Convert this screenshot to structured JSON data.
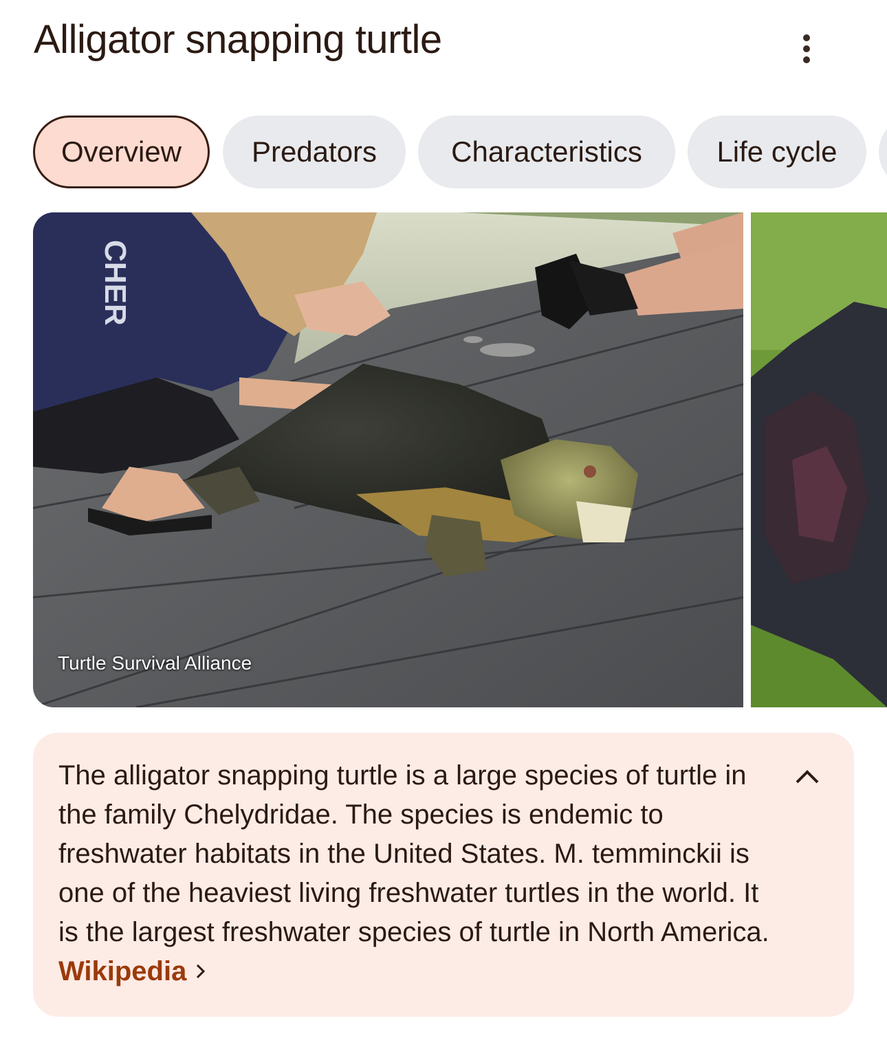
{
  "header": {
    "title": "Alligator snapping turtle",
    "more_icon": "more-vert-icon"
  },
  "tabs": [
    {
      "label": "Overview",
      "active": true
    },
    {
      "label": "Predators",
      "active": false
    },
    {
      "label": "Characteristics",
      "active": false
    },
    {
      "label": "Life cycle",
      "active": false
    }
  ],
  "images": {
    "main_caption": "Turtle Survival Alliance"
  },
  "description": {
    "text": "The alligator snapping turtle is a large species of turtle in the family Chelydridae. The species is endemic to freshwater habitats in the United States. M. temminckii is one of the heaviest living freshwater turtles in the world. It is the largest freshwater species of turtle in North America.",
    "source_link": "Wikipedia",
    "link_icon": "chevron-right-icon",
    "collapse_icon": "chevron-up-icon"
  },
  "colors": {
    "active_tab_bg": "#fddbd0",
    "tab_bg": "#e8eaed",
    "card_bg": "#fdebe5",
    "link": "#9b3a0a"
  }
}
